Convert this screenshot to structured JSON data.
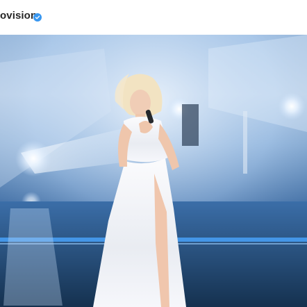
{
  "post": {
    "account_name": "ovision",
    "verified": true,
    "verified_icon": "verified-badge-icon",
    "photo_description_icon": "stage-performance-photo"
  },
  "colors": {
    "accent_verified": "#3897f0",
    "text_primary": "#262626",
    "stage_blue": "#2f5f96"
  }
}
